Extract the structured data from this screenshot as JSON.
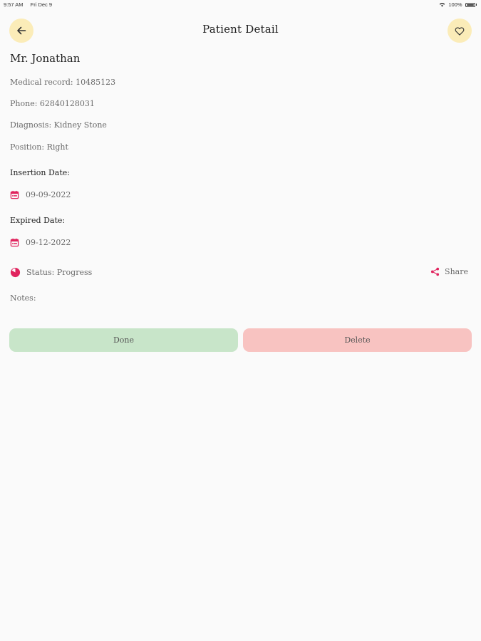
{
  "status_bar": {
    "time": "9:57 AM",
    "date": "Fri Dec 9",
    "battery": "100%"
  },
  "header": {
    "title": "Patient Detail",
    "back_icon": "arrow-left-icon",
    "favorite_icon": "heart-outline-icon"
  },
  "patient": {
    "name": "Mr. Jonathan",
    "medical_record": "Medical record: 10485123",
    "phone": "Phone: 62840128031",
    "diagnosis": "Diagnosis: Kidney Stone",
    "position": "Position: Right"
  },
  "insertion": {
    "label": "Insertion Date:",
    "date": "09-09-2022"
  },
  "expired": {
    "label": "Expired Date:",
    "date": "09-12-2022"
  },
  "status": {
    "text": "Status: Progress"
  },
  "share": {
    "label": "Share"
  },
  "notes": {
    "label": "Notes:"
  },
  "actions": {
    "done_label": "Done",
    "delete_label": "Delete"
  },
  "colors": {
    "accent": "#e0245e",
    "icon_bg": "#fbecb8",
    "done_bg": "#c8e5c9",
    "delete_bg": "#f8c3c1"
  }
}
